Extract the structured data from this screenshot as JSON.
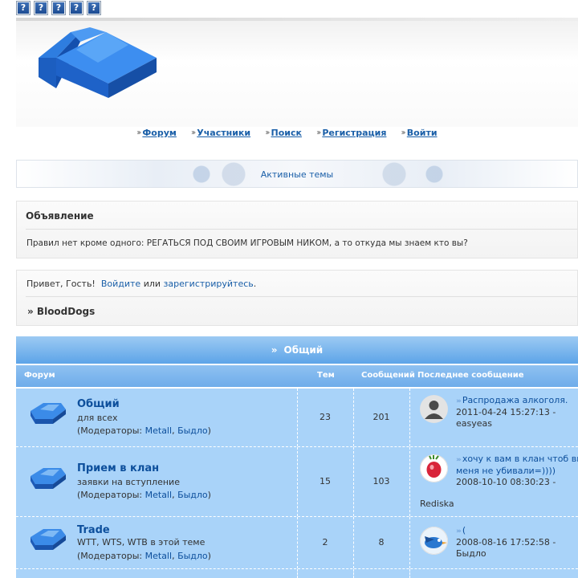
{
  "top_icons": [
    "?",
    "?",
    "?",
    "?",
    "?"
  ],
  "nav": [
    {
      "label": "Форум"
    },
    {
      "label": "Участники"
    },
    {
      "label": "Поиск"
    },
    {
      "label": "Регистрация"
    },
    {
      "label": "Войти"
    }
  ],
  "active_topics": "Активные темы",
  "announcement": {
    "title": "Объявление",
    "text": "Правил нет кроме одного: РЕГАТЬСЯ ПОД СВОИМ ИГРОВЫМ НИКОМ, а то откуда мы знаем кто вы?"
  },
  "welcome": {
    "greeting": "Привет, Гость!",
    "login": "Войдите",
    "or": "или",
    "register": "зарегистрируйтесь",
    "dot": ".",
    "crumb": "» BloodDogs"
  },
  "category": {
    "arrow": "»",
    "title": "Общий"
  },
  "columns": {
    "forum": "Форум",
    "topics": "Тем",
    "posts": "Сообщений",
    "last": "Последнее сообщение"
  },
  "forums": [
    {
      "title": "Общий",
      "desc": "для всех",
      "mods_prefix": "(Модераторы: ",
      "mod1": "Metall",
      "comma": ", ",
      "mod2": "Быдло",
      "mods_suffix": ")",
      "topics": "23",
      "posts": "201",
      "last_title": "Распродажа алкоголя.",
      "last_date": "2011-04-24 15:27:13 -",
      "last_user": "easyeas"
    },
    {
      "title": "Прием в клан",
      "desc": "заявки на вступление",
      "mods_prefix": "(Модераторы: ",
      "mod1": "Metall",
      "comma": ", ",
      "mod2": "Быдло",
      "mods_suffix": ")",
      "topics": "15",
      "posts": "103",
      "last_title": "хочу к вам в клан чтоб вы меня не убивали=))))",
      "last_date": "2008-10-10 08:30:23 -",
      "last_user": "Rediska"
    },
    {
      "title": "Trade",
      "desc": "WTT, WTS, WTB в этой теме",
      "mods_prefix": "(Модераторы: ",
      "mod1": "Metall",
      "comma": ", ",
      "mod2": "Быдло",
      "mods_suffix": ")",
      "topics": "2",
      "posts": "8",
      "last_title": "(",
      "last_date": "2008-08-16 17:52:58 -",
      "last_user": "Быдло"
    }
  ]
}
